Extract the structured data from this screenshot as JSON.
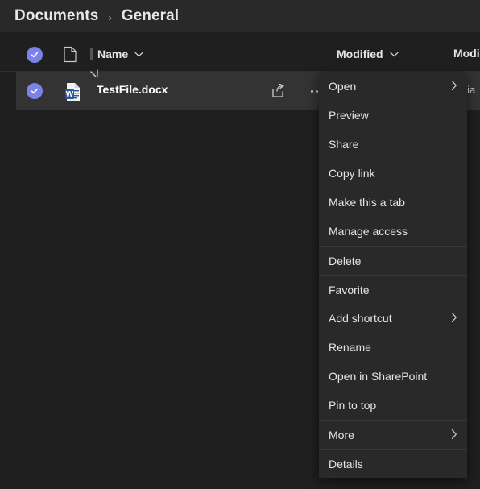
{
  "breadcrumb": {
    "items": [
      "Documents",
      "General"
    ],
    "separator": "›"
  },
  "column_header": {
    "select_all_icon": "checked-circle-icon",
    "file_type_icon": "file-outline-icon",
    "columns": [
      {
        "label": "Name",
        "sort_icon": "chevron-down-icon"
      },
      {
        "label": "Modified",
        "sort_icon": "chevron-down-icon"
      },
      {
        "label": "Modi",
        "sort_icon": "chevron-down-icon"
      }
    ]
  },
  "file_row": {
    "selected": true,
    "checkbox_icon": "checked-circle-icon",
    "file_icon": "word-document-icon",
    "file_name": "TestFile.docx",
    "share_icon": "share-icon",
    "more_actions_icon": "ellipsis-icon",
    "modified_by": "ulia",
    "cursor_icon": "busy-cursor-icon"
  },
  "context_menu": {
    "items": [
      {
        "label": "Open",
        "has_submenu": true,
        "submenu_icon": "chevron-right-icon",
        "separator_above": false
      },
      {
        "label": "Preview",
        "has_submenu": false,
        "submenu_icon": "",
        "separator_above": false
      },
      {
        "label": "Share",
        "has_submenu": false,
        "submenu_icon": "",
        "separator_above": false
      },
      {
        "label": "Copy link",
        "has_submenu": false,
        "submenu_icon": "",
        "separator_above": false
      },
      {
        "label": "Make this a tab",
        "has_submenu": false,
        "submenu_icon": "",
        "separator_above": false
      },
      {
        "label": "Manage access",
        "has_submenu": false,
        "submenu_icon": "",
        "separator_above": false
      },
      {
        "label": "Delete",
        "has_submenu": false,
        "submenu_icon": "",
        "separator_above": true
      },
      {
        "label": "Favorite",
        "has_submenu": false,
        "submenu_icon": "",
        "separator_above": true
      },
      {
        "label": "Add shortcut",
        "has_submenu": true,
        "submenu_icon": "chevron-right-icon",
        "separator_above": false
      },
      {
        "label": "Rename",
        "has_submenu": false,
        "submenu_icon": "",
        "separator_above": false
      },
      {
        "label": "Open in SharePoint",
        "has_submenu": false,
        "submenu_icon": "",
        "separator_above": false
      },
      {
        "label": "Pin to top",
        "has_submenu": false,
        "submenu_icon": "",
        "separator_above": false
      },
      {
        "label": "More",
        "has_submenu": true,
        "submenu_icon": "chevron-right-icon",
        "separator_above": true
      },
      {
        "label": "Details",
        "has_submenu": false,
        "submenu_icon": "",
        "separator_above": true
      }
    ]
  },
  "colors": {
    "app_background": "#1f1f1f",
    "breadcrumb_background": "#292929",
    "selected_row_background": "#333333",
    "menu_background": "#292929",
    "accent_checkbox": "#7b83eb",
    "word_blue": "#2b579a",
    "text_primary": "#e8e8e8"
  }
}
